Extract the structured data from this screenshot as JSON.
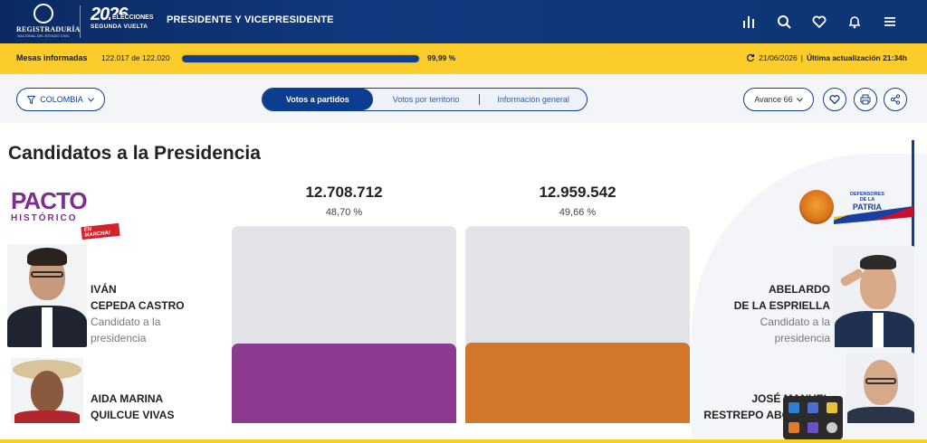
{
  "header": {
    "registry_name": "REGISTRADURÍA",
    "registry_sub": "NACIONAL DEL ESTADO CIVIL",
    "election_year": "2026",
    "election_word": "ELECCIONES",
    "election_round": "SEGUNDA VUELTA",
    "section_title": "PRESIDENTE Y VICEPRESIDENTE",
    "icons": [
      "chart-icon",
      "search-icon",
      "heart-icon",
      "bell-icon",
      "menu-icon"
    ]
  },
  "status": {
    "label": "Mesas informadas",
    "count_text": "122.017 de 122.020",
    "progress_fraction": 0.9999,
    "percent_text": "99,99 %",
    "date": "21/06/2026",
    "separator": "|",
    "update_text": "Última actualización 21:34h"
  },
  "toolbar": {
    "country": "COLOMBIA",
    "tabs": [
      {
        "label": "Votos a partidos",
        "active": true
      },
      {
        "label": "Votos por territorio",
        "active": false
      },
      {
        "label": "Información general",
        "active": false
      }
    ],
    "avance": "Avance 66"
  },
  "main": {
    "title": "Candidatos a la Presidencia",
    "left_party": {
      "logo_text_1": "PACTO",
      "logo_text_2": "HISTÓRICO",
      "logo_tag": "EN MARCHA!"
    },
    "right_party": {
      "logo_text_1": "DEFENSORES",
      "logo_text_2": "DE LA",
      "logo_text_3": "PATRIA"
    },
    "results": [
      {
        "votes": "12.708.712",
        "percent": "48,70 %",
        "fraction": 0.487,
        "color": "#8b3a8f"
      },
      {
        "votes": "12.959.542",
        "percent": "49,66 %",
        "fraction": 0.4966,
        "color": "#d2772a"
      }
    ],
    "candidates": [
      {
        "line1": "IVÁN",
        "line2": "CEPEDA CASTRO",
        "role1": "Candidato a la",
        "role2": "presidencia"
      },
      {
        "line1": "AIDA MARINA",
        "line2": "QUILCUE VIVAS"
      },
      {
        "line1": "ABELARDO",
        "line2": "DE LA ESPRIELLA",
        "role1": "Candidato a la",
        "role2": "presidencia"
      },
      {
        "line1": "JOSÉ MANUEL",
        "line2": "RESTREPO ABONDANO"
      }
    ]
  }
}
